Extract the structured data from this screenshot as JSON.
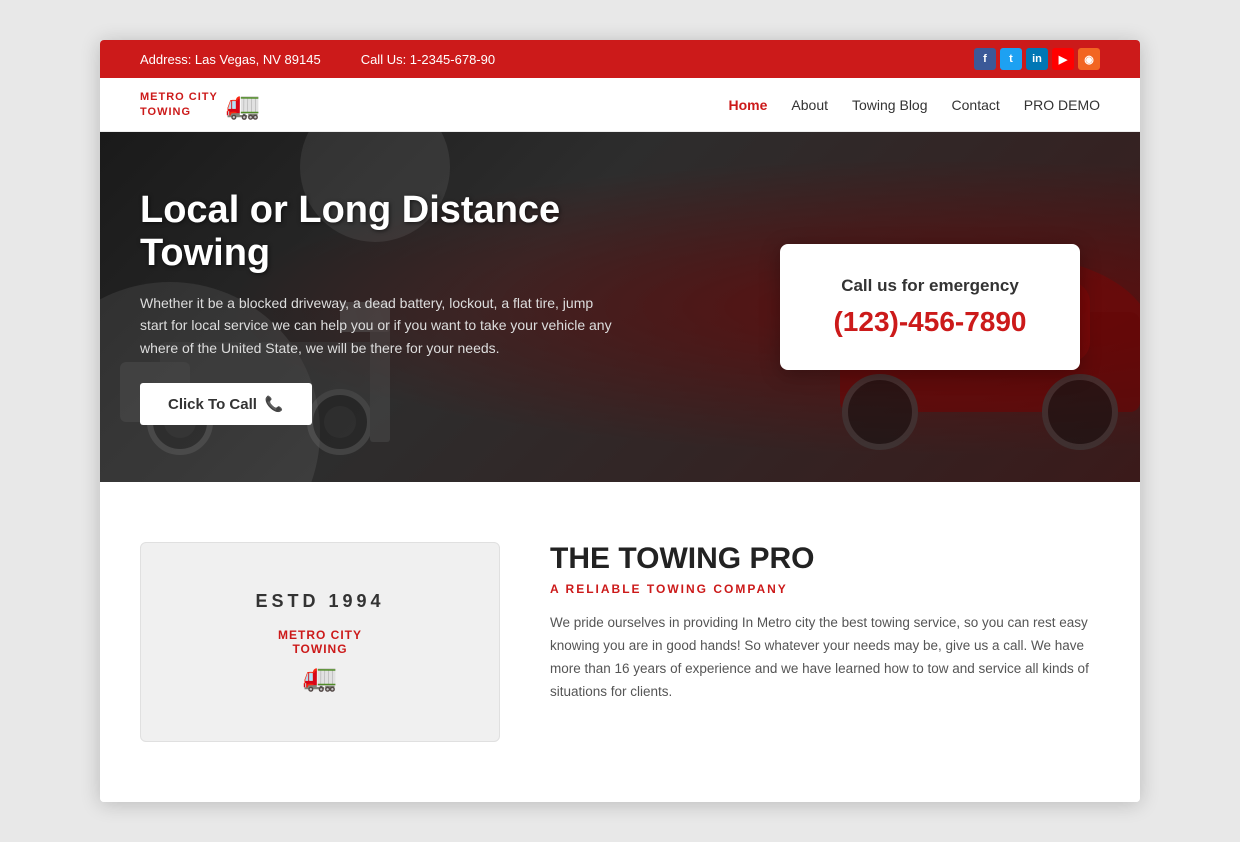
{
  "topbar": {
    "address_label": "Address: Las Vegas, NV 89145",
    "call_label": "Call Us: 1-2345-678-90",
    "social": [
      {
        "name": "facebook",
        "label": "f",
        "class": "si-fb"
      },
      {
        "name": "twitter",
        "label": "t",
        "class": "si-tw"
      },
      {
        "name": "linkedin",
        "label": "in",
        "class": "si-li"
      },
      {
        "name": "youtube",
        "label": "▶",
        "class": "si-yt"
      },
      {
        "name": "rss",
        "label": "◉",
        "class": "si-rss"
      }
    ]
  },
  "logo": {
    "line1": "METRO CITY",
    "line2": "TOWING"
  },
  "nav": {
    "links": [
      {
        "label": "Home",
        "active": true
      },
      {
        "label": "About",
        "active": false
      },
      {
        "label": "Towing Blog",
        "active": false
      },
      {
        "label": "Contact",
        "active": false
      },
      {
        "label": "PRO DEMO",
        "active": false
      }
    ]
  },
  "hero": {
    "title": "Local or Long Distance Towing",
    "description": "Whether it be a blocked driveway, a dead battery, lockout, a flat tire, jump start for local service we can help you or if you want to take your vehicle any where of the United State, we will be there for your needs.",
    "cta_label": "Click To Call",
    "emergency_label": "Call us for emergency",
    "emergency_phone": "(123)-456-7890"
  },
  "about": {
    "estd": "ESTD  1994",
    "logo_line1": "METRO CITY",
    "logo_line2": "TOWING",
    "title": "THE TOWING PRO",
    "subtitle": "A RELIABLE TOWING COMPANY",
    "description": "We pride ourselves in providing In Metro city the best towing service, so you can rest easy knowing you are in good hands! So whatever your needs may be, give us a call. We have more than 16 years of experience and we have learned how to tow and service all kinds of situations for clients."
  }
}
